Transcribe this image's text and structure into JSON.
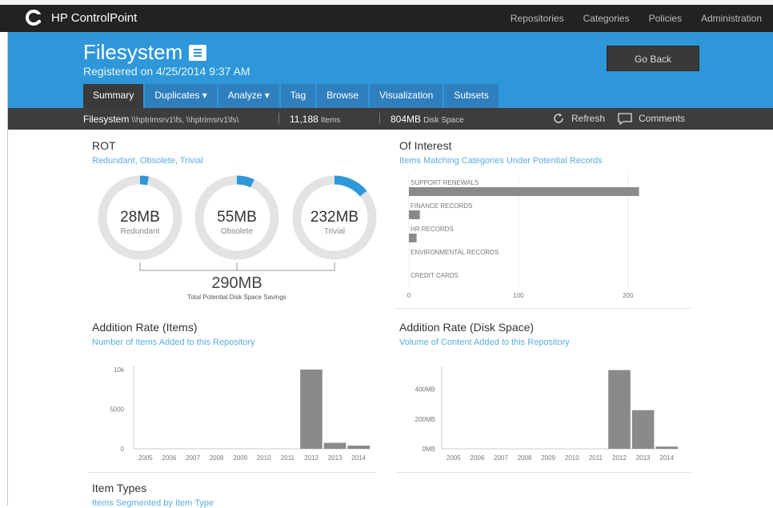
{
  "app": {
    "brand": "HP ControlPoint"
  },
  "topnav": [
    "Repositories",
    "Categories",
    "Policies",
    "Administration"
  ],
  "header": {
    "title": "Filesystem",
    "registered": "Registered on 4/25/2014 9:37 AM",
    "go_back": "Go Back"
  },
  "tabs": [
    "Summary",
    "Duplicates ▾",
    "Analyze ▾",
    "Tag",
    "Browse",
    "Visualization",
    "Subsets"
  ],
  "infobar": {
    "repo_name": "Filesystem",
    "repo_path": "\\\\hptrimsrv1\\fs, \\\\hptrimsrv1\\fs\\",
    "items_count": "11,188",
    "items_label": "Items",
    "disk_value": "804MB",
    "disk_label": "Disk Space",
    "refresh": "Refresh",
    "comments": "Comments"
  },
  "rot": {
    "title": "ROT",
    "subtitle": "Redundant, Obsolete, Trivial",
    "donuts": [
      {
        "value": "28MB",
        "label": "Redundant",
        "fraction": 0.034
      },
      {
        "value": "55MB",
        "label": "Obsolete",
        "fraction": 0.068
      },
      {
        "value": "232MB",
        "label": "Trivial",
        "fraction": 0.14
      }
    ],
    "total": "290MB",
    "total_label": "Total Potential Disk Space Savings"
  },
  "colors": {
    "accent": "#2e97d9",
    "bar": "#8a8a8a",
    "ring": "#e3e3e3"
  },
  "of_interest": {
    "title": "Of Interest",
    "subtitle": "Items Matching Categories Under Potential Records"
  },
  "rate_items": {
    "title": "Addition Rate (Items)",
    "subtitle": "Number of Items Added to this Repository"
  },
  "rate_disk": {
    "title": "Addition Rate (Disk Space)",
    "subtitle": "Volume of Content Added to this Repository"
  },
  "item_types": {
    "title": "Item Types",
    "subtitle": "Items Segmented by Item Type"
  },
  "chart_data": [
    {
      "type": "bar",
      "orientation": "horizontal",
      "categories": [
        "SUPPORT RENEWALS",
        "FINANCE RECORDS",
        "HR RECORDS",
        "ENVIRONMENTAL RECORDS",
        "CREDIT CARDS"
      ],
      "values": [
        210,
        10,
        7,
        0,
        0
      ],
      "xlim": [
        0,
        230
      ],
      "xticks": [
        "0",
        "100",
        "200"
      ],
      "xtick_values": [
        0,
        100,
        200
      ],
      "grid": true
    },
    {
      "type": "bar",
      "categories": [
        "2005",
        "2006",
        "2007",
        "2008",
        "2009",
        "2010",
        "2011",
        "2012",
        "2013",
        "2014"
      ],
      "values": [
        0,
        0,
        0,
        0,
        0,
        0,
        0,
        10000,
        750,
        400
      ],
      "ylim": [
        0,
        10500
      ],
      "yticks": [
        "0",
        "5000",
        "10k"
      ],
      "ytick_values": [
        0,
        5000,
        10000
      ]
    },
    {
      "type": "bar",
      "categories": [
        "2005",
        "2006",
        "2007",
        "2008",
        "2009",
        "2010",
        "2011",
        "2012",
        "2013",
        "2014"
      ],
      "values": [
        0,
        0,
        0,
        0,
        0,
        0,
        0,
        530,
        260,
        15
      ],
      "ylim": [
        0,
        560
      ],
      "yticks": [
        "0MB",
        "200MB",
        "400MB"
      ],
      "ytick_values": [
        0,
        200,
        400
      ]
    }
  ]
}
